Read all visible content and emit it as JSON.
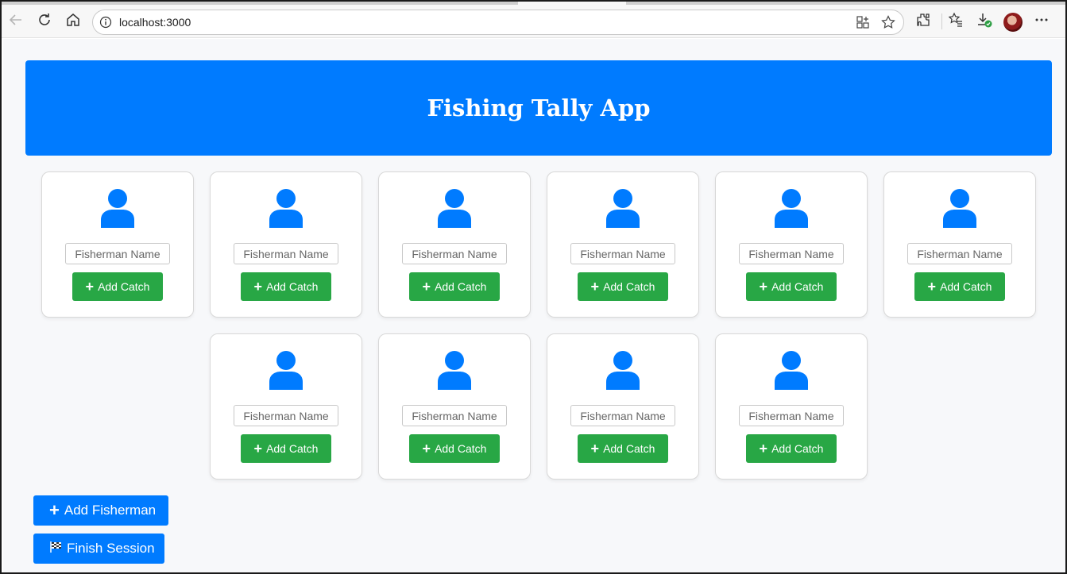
{
  "browser": {
    "url": "localhost:3000"
  },
  "app": {
    "title": "Fishing Tally App"
  },
  "fishermen": [
    {
      "placeholder": "Fisherman Name",
      "add_catch_label": "Add Catch"
    },
    {
      "placeholder": "Fisherman Name",
      "add_catch_label": "Add Catch"
    },
    {
      "placeholder": "Fisherman Name",
      "add_catch_label": "Add Catch"
    },
    {
      "placeholder": "Fisherman Name",
      "add_catch_label": "Add Catch"
    },
    {
      "placeholder": "Fisherman Name",
      "add_catch_label": "Add Catch"
    },
    {
      "placeholder": "Fisherman Name",
      "add_catch_label": "Add Catch"
    },
    {
      "placeholder": "Fisherman Name",
      "add_catch_label": "Add Catch"
    },
    {
      "placeholder": "Fisherman Name",
      "add_catch_label": "Add Catch"
    },
    {
      "placeholder": "Fisherman Name",
      "add_catch_label": "Add Catch"
    },
    {
      "placeholder": "Fisherman Name",
      "add_catch_label": "Add Catch"
    }
  ],
  "actions": {
    "add_fisherman_label": "Add Fisherman",
    "finish_session_label": "Finish Session"
  },
  "colors": {
    "primary": "#007bff",
    "success": "#28a745",
    "background": "#f7f8fa"
  },
  "icons": {
    "person": "person-icon",
    "plus": "plus-icon",
    "flag": "checkered-flag-icon"
  }
}
